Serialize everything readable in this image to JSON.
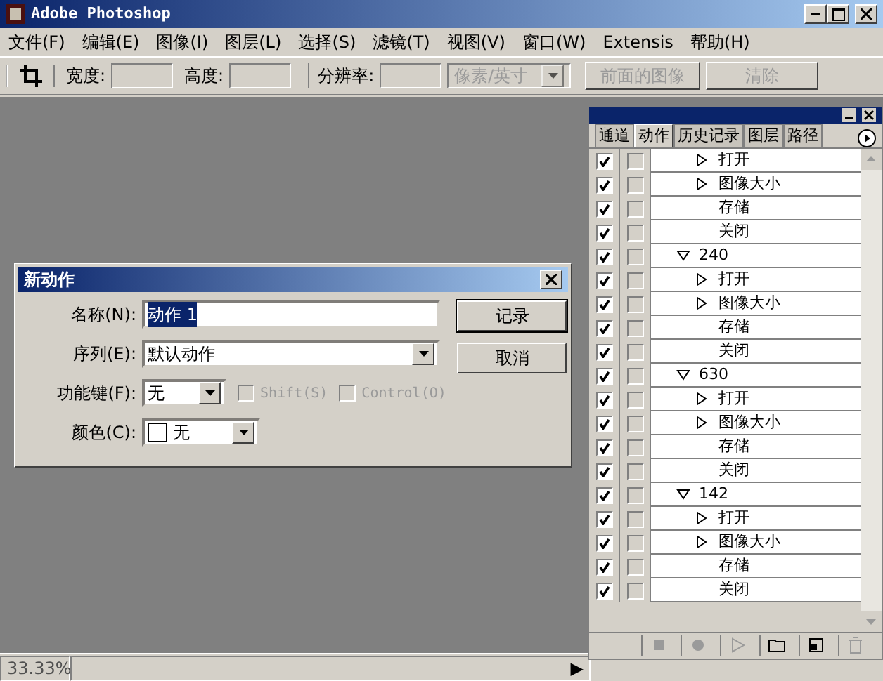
{
  "window": {
    "title": "Adobe Photoshop"
  },
  "menu": [
    "文件(F)",
    "编辑(E)",
    "图像(I)",
    "图层(L)",
    "选择(S)",
    "滤镜(T)",
    "视图(V)",
    "窗口(W)",
    "Extensis",
    "帮助(H)"
  ],
  "options_bar": {
    "width_label": "宽度:",
    "height_label": "高度:",
    "resolution_label": "分辨率:",
    "unit": "像素/英寸",
    "unit_disabled": true,
    "buttons": [
      {
        "label": "前面的图像",
        "disabled": true
      },
      {
        "label": "清除",
        "disabled": true
      }
    ]
  },
  "dialog": {
    "title": "新动作",
    "name_label": "名称(N):",
    "name_value": "动作 1",
    "name_selected": true,
    "set_label": "序列(E):",
    "set_value": "默认动作",
    "key_label": "功能键(F):",
    "key_value": "无",
    "modifiers": [
      {
        "label": "Shift(S)",
        "checked": false,
        "disabled": true
      },
      {
        "label": "Control(O)",
        "checked": false,
        "disabled": true
      }
    ],
    "color_label": "颜色(C):",
    "color_value": "无",
    "buttons": [
      "记录",
      "取消"
    ]
  },
  "panel": {
    "tabs": [
      {
        "label": "通道",
        "selected": false
      },
      {
        "label": "动作",
        "selected": true
      },
      {
        "label": "历史记录",
        "selected": false
      },
      {
        "label": "图层",
        "selected": false
      },
      {
        "label": "路径",
        "selected": false
      }
    ],
    "items": [
      {
        "kind": "command",
        "label": "打开",
        "checked": true,
        "dialog": false
      },
      {
        "kind": "command",
        "label": "图像大小",
        "checked": true,
        "dialog": false
      },
      {
        "kind": "step",
        "label": "存储",
        "checked": true,
        "dialog": false
      },
      {
        "kind": "step",
        "label": "关闭",
        "checked": true,
        "dialog": false
      },
      {
        "kind": "set",
        "label": "240",
        "expanded": true,
        "checked": true,
        "dialog": false,
        "children": [
          {
            "kind": "command",
            "label": "打开",
            "checked": true,
            "dialog": false
          },
          {
            "kind": "command",
            "label": "图像大小",
            "checked": true,
            "dialog": false
          },
          {
            "kind": "step",
            "label": "存储",
            "checked": true,
            "dialog": false
          },
          {
            "kind": "step",
            "label": "关闭",
            "checked": true,
            "dialog": false
          }
        ]
      },
      {
        "kind": "set",
        "label": "630",
        "expanded": true,
        "checked": true,
        "dialog": false,
        "children": [
          {
            "kind": "command",
            "label": "打开",
            "checked": true,
            "dialog": false
          },
          {
            "kind": "command",
            "label": "图像大小",
            "checked": true,
            "dialog": false
          },
          {
            "kind": "step",
            "label": "存储",
            "checked": true,
            "dialog": false
          },
          {
            "kind": "step",
            "label": "关闭",
            "checked": true,
            "dialog": false
          }
        ]
      },
      {
        "kind": "set",
        "label": "142",
        "expanded": true,
        "checked": true,
        "dialog": false,
        "children": [
          {
            "kind": "command",
            "label": "打开",
            "checked": true,
            "dialog": false
          },
          {
            "kind": "command",
            "label": "图像大小",
            "checked": true,
            "dialog": false
          },
          {
            "kind": "step",
            "label": "存储",
            "checked": true,
            "dialog": false
          },
          {
            "kind": "step",
            "label": "关闭",
            "checked": true,
            "dialog": false
          }
        ]
      }
    ]
  },
  "status_bar": {
    "zoom": "33.33%",
    "arrow": "▶"
  }
}
